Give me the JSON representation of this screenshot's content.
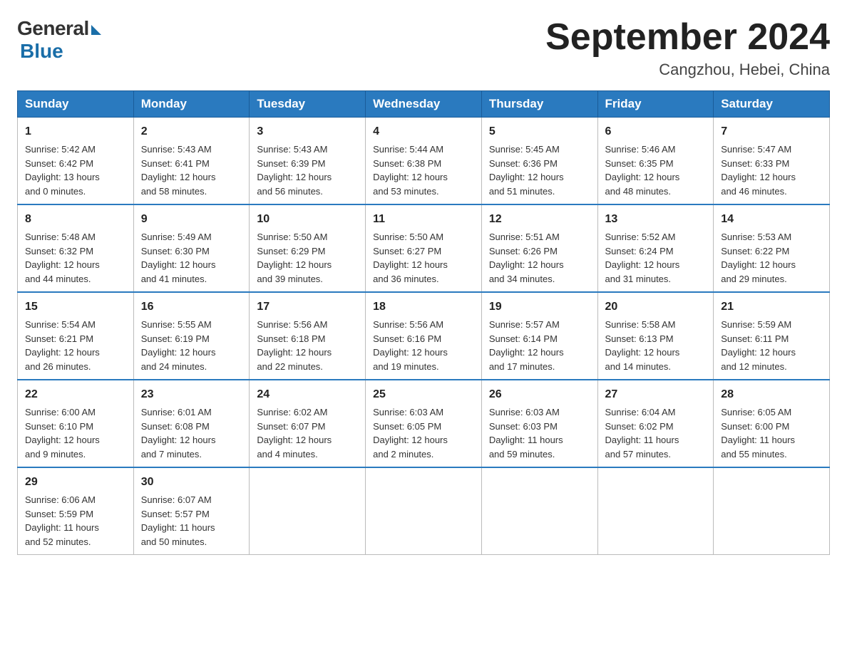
{
  "logo": {
    "general": "General",
    "blue": "Blue"
  },
  "title": "September 2024",
  "location": "Cangzhou, Hebei, China",
  "days_of_week": [
    "Sunday",
    "Monday",
    "Tuesday",
    "Wednesday",
    "Thursday",
    "Friday",
    "Saturday"
  ],
  "weeks": [
    [
      {
        "day": "1",
        "sunrise": "5:42 AM",
        "sunset": "6:42 PM",
        "daylight": "13 hours and 0 minutes."
      },
      {
        "day": "2",
        "sunrise": "5:43 AM",
        "sunset": "6:41 PM",
        "daylight": "12 hours and 58 minutes."
      },
      {
        "day": "3",
        "sunrise": "5:43 AM",
        "sunset": "6:39 PM",
        "daylight": "12 hours and 56 minutes."
      },
      {
        "day": "4",
        "sunrise": "5:44 AM",
        "sunset": "6:38 PM",
        "daylight": "12 hours and 53 minutes."
      },
      {
        "day": "5",
        "sunrise": "5:45 AM",
        "sunset": "6:36 PM",
        "daylight": "12 hours and 51 minutes."
      },
      {
        "day": "6",
        "sunrise": "5:46 AM",
        "sunset": "6:35 PM",
        "daylight": "12 hours and 48 minutes."
      },
      {
        "day": "7",
        "sunrise": "5:47 AM",
        "sunset": "6:33 PM",
        "daylight": "12 hours and 46 minutes."
      }
    ],
    [
      {
        "day": "8",
        "sunrise": "5:48 AM",
        "sunset": "6:32 PM",
        "daylight": "12 hours and 44 minutes."
      },
      {
        "day": "9",
        "sunrise": "5:49 AM",
        "sunset": "6:30 PM",
        "daylight": "12 hours and 41 minutes."
      },
      {
        "day": "10",
        "sunrise": "5:50 AM",
        "sunset": "6:29 PM",
        "daylight": "12 hours and 39 minutes."
      },
      {
        "day": "11",
        "sunrise": "5:50 AM",
        "sunset": "6:27 PM",
        "daylight": "12 hours and 36 minutes."
      },
      {
        "day": "12",
        "sunrise": "5:51 AM",
        "sunset": "6:26 PM",
        "daylight": "12 hours and 34 minutes."
      },
      {
        "day": "13",
        "sunrise": "5:52 AM",
        "sunset": "6:24 PM",
        "daylight": "12 hours and 31 minutes."
      },
      {
        "day": "14",
        "sunrise": "5:53 AM",
        "sunset": "6:22 PM",
        "daylight": "12 hours and 29 minutes."
      }
    ],
    [
      {
        "day": "15",
        "sunrise": "5:54 AM",
        "sunset": "6:21 PM",
        "daylight": "12 hours and 26 minutes."
      },
      {
        "day": "16",
        "sunrise": "5:55 AM",
        "sunset": "6:19 PM",
        "daylight": "12 hours and 24 minutes."
      },
      {
        "day": "17",
        "sunrise": "5:56 AM",
        "sunset": "6:18 PM",
        "daylight": "12 hours and 22 minutes."
      },
      {
        "day": "18",
        "sunrise": "5:56 AM",
        "sunset": "6:16 PM",
        "daylight": "12 hours and 19 minutes."
      },
      {
        "day": "19",
        "sunrise": "5:57 AM",
        "sunset": "6:14 PM",
        "daylight": "12 hours and 17 minutes."
      },
      {
        "day": "20",
        "sunrise": "5:58 AM",
        "sunset": "6:13 PM",
        "daylight": "12 hours and 14 minutes."
      },
      {
        "day": "21",
        "sunrise": "5:59 AM",
        "sunset": "6:11 PM",
        "daylight": "12 hours and 12 minutes."
      }
    ],
    [
      {
        "day": "22",
        "sunrise": "6:00 AM",
        "sunset": "6:10 PM",
        "daylight": "12 hours and 9 minutes."
      },
      {
        "day": "23",
        "sunrise": "6:01 AM",
        "sunset": "6:08 PM",
        "daylight": "12 hours and 7 minutes."
      },
      {
        "day": "24",
        "sunrise": "6:02 AM",
        "sunset": "6:07 PM",
        "daylight": "12 hours and 4 minutes."
      },
      {
        "day": "25",
        "sunrise": "6:03 AM",
        "sunset": "6:05 PM",
        "daylight": "12 hours and 2 minutes."
      },
      {
        "day": "26",
        "sunrise": "6:03 AM",
        "sunset": "6:03 PM",
        "daylight": "11 hours and 59 minutes."
      },
      {
        "day": "27",
        "sunrise": "6:04 AM",
        "sunset": "6:02 PM",
        "daylight": "11 hours and 57 minutes."
      },
      {
        "day": "28",
        "sunrise": "6:05 AM",
        "sunset": "6:00 PM",
        "daylight": "11 hours and 55 minutes."
      }
    ],
    [
      {
        "day": "29",
        "sunrise": "6:06 AM",
        "sunset": "5:59 PM",
        "daylight": "11 hours and 52 minutes."
      },
      {
        "day": "30",
        "sunrise": "6:07 AM",
        "sunset": "5:57 PM",
        "daylight": "11 hours and 50 minutes."
      },
      null,
      null,
      null,
      null,
      null
    ]
  ],
  "labels": {
    "sunrise": "Sunrise:",
    "sunset": "Sunset:",
    "daylight": "Daylight:"
  }
}
